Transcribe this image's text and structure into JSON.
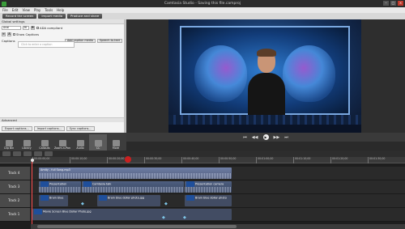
{
  "window": {
    "title": "Camtasia Studio - Saving this file.camproj"
  },
  "menu": [
    "File",
    "Edit",
    "View",
    "Play",
    "Tools",
    "Help"
  ],
  "toolbar": {
    "record": "Record the screen",
    "import": "Import media",
    "produce": "Produce and share"
  },
  "left_panel": {
    "global_settings": "Global settings",
    "font": "Arial",
    "size": "36",
    "ada_compliant": "ADA compliant",
    "show_captions": "Show Captions",
    "captions_label": "Captions",
    "add_caption_media": "Add caption media",
    "speech_to_text": "Speech-to-text",
    "caption_placeholder": "Click to enter a caption",
    "advanced": "Advanced",
    "export_captions": "Export captions...",
    "import_captions": "Import captions...",
    "sync_captions": "Sync captions..."
  },
  "tabs": [
    {
      "label": "Clip Bin"
    },
    {
      "label": "Library"
    },
    {
      "label": "Callouts"
    },
    {
      "label": "Zoom-n-Pan"
    },
    {
      "label": "Audio"
    },
    {
      "label": "CC"
    },
    {
      "label": "More"
    }
  ],
  "ruler_ticks": [
    "00:00:00;00",
    "00:00:10;00",
    "00:00:20;00",
    "00:00:30;00",
    "00:00:40;00",
    "00:00:50;00",
    "00:01:00;00",
    "00:01:10;00",
    "00:01:20;00",
    "00:01:30;00"
  ],
  "tracks": [
    {
      "label": "Track 4",
      "clips": [
        {
          "name": "Amity - full Song.mp3"
        }
      ]
    },
    {
      "label": "Track 3",
      "clips": [
        {
          "name": "Presentation"
        },
        {
          "name": "Camtasia talk"
        },
        {
          "name": "Presentation camera"
        }
      ]
    },
    {
      "label": "Track 2",
      "clips": [
        {
          "name": "Brain blue"
        },
        {
          "name": "Brain blue dollar photo.jpg"
        },
        {
          "name": "Brain blue dollar photo"
        }
      ]
    },
    {
      "label": "Track 1",
      "clips": [
        {
          "name": "Movie Screen Blue Dollar Photo.jpg"
        }
      ]
    }
  ]
}
